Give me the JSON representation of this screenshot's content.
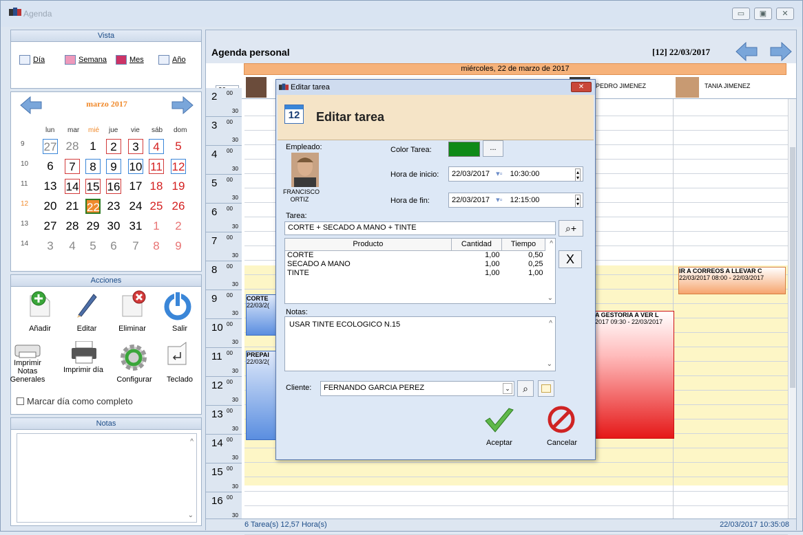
{
  "window": {
    "title": "Agenda",
    "btn_min": "▭",
    "btn_max": "▣",
    "btn_close": "✕"
  },
  "vista": {
    "header": "Vista",
    "buttons": [
      "Día",
      "Semana",
      "Mes",
      "Año"
    ]
  },
  "calendar": {
    "month": "marzo 2017",
    "dow": [
      "lun",
      "mar",
      "mié",
      "jue",
      "vie",
      "sáb",
      "dom"
    ],
    "weeks": [
      {
        "num": "9",
        "days": [
          "27",
          "28",
          "1",
          "2",
          "3",
          "4",
          "5"
        ]
      },
      {
        "num": "10",
        "days": [
          "6",
          "7",
          "8",
          "9",
          "10",
          "11",
          "12"
        ]
      },
      {
        "num": "11",
        "days": [
          "13",
          "14",
          "15",
          "16",
          "17",
          "18",
          "19"
        ]
      },
      {
        "num": "12",
        "days": [
          "20",
          "21",
          "22",
          "23",
          "24",
          "25",
          "26"
        ]
      },
      {
        "num": "13",
        "days": [
          "27",
          "28",
          "29",
          "30",
          "31",
          "1",
          "2"
        ]
      },
      {
        "num": "14",
        "days": [
          "3",
          "4",
          "5",
          "6",
          "7",
          "8",
          "9"
        ]
      }
    ]
  },
  "acciones": {
    "header": "Acciones",
    "add": "Añadir",
    "edit": "Editar",
    "delete": "Eliminar",
    "exit": "Salir",
    "print_notes": "Imprimir Notas Generales",
    "print_day": "Imprimir día",
    "config": "Configurar",
    "keyboard": "Teclado",
    "mark_complete": "Marcar día como completo"
  },
  "notas_panel": {
    "header": "Notas"
  },
  "agenda": {
    "title": "Agenda personal",
    "week_date": "[12]  22/03/2017",
    "day_header": "miércoles, 22 de marzo de 2017",
    "interval": "30",
    "employees": [
      "PEDRO JIMENEZ",
      "TANIA JIMENEZ"
    ],
    "hours": [
      "2",
      "3",
      "4",
      "5",
      "6",
      "7",
      "8",
      "9",
      "10",
      "11",
      "12",
      "13",
      "14",
      "15",
      "16"
    ],
    "m00": "00",
    "m30": "30",
    "events": [
      {
        "title": "CORTE",
        "time": "22/03/2("
      },
      {
        "title": "PREPAI",
        "time": "22/03/2("
      },
      {
        "title": "A GESTORIA A VER L",
        "time": "2017 09:30 - 22/03/2017"
      },
      {
        "title": "IR A CORREOS A LLEVAR C",
        "time": "22/03/2017 08:00 - 22/03/2017"
      }
    ],
    "status_left": "6 Tarea(s)  12,57 Hora(s)",
    "status_right": "22/03/2017  10:35:08"
  },
  "dialog": {
    "window_title": "Editar tarea",
    "heading": "Editar tarea",
    "icon_day": "12",
    "empleado_label": "Empleado:",
    "empleado_name": "FRANCISCO ORTIZ",
    "color_label": "Color Tarea:",
    "color": "#0f8a17",
    "dots": "...",
    "inicio_label": "Hora de inicio:",
    "inicio_date": "22/03/2017",
    "inicio_time": "10:30:00",
    "fin_label": "Hora de fin:",
    "fin_date": "22/03/2017",
    "fin_time": "12:15:00",
    "tarea_label": "Tarea:",
    "tarea_value": "CORTE + SECADO A MANO + TINTE",
    "cols": [
      "Producto",
      "Cantidad",
      "Tiempo"
    ],
    "rows": [
      {
        "p": "CORTE",
        "c": "1,00",
        "t": "0,50"
      },
      {
        "p": "SECADO A MANO",
        "c": "1,00",
        "t": "0,25"
      },
      {
        "p": "TINTE",
        "c": "1,00",
        "t": "1,00"
      }
    ],
    "remove": "X",
    "notas_label": "Notas:",
    "notas_value": "USAR TINTE ECOLOGICO N.15",
    "cliente_label": "Cliente:",
    "cliente_value": "FERNANDO GARCIA PEREZ",
    "accept": "Aceptar",
    "cancel": "Cancelar"
  }
}
